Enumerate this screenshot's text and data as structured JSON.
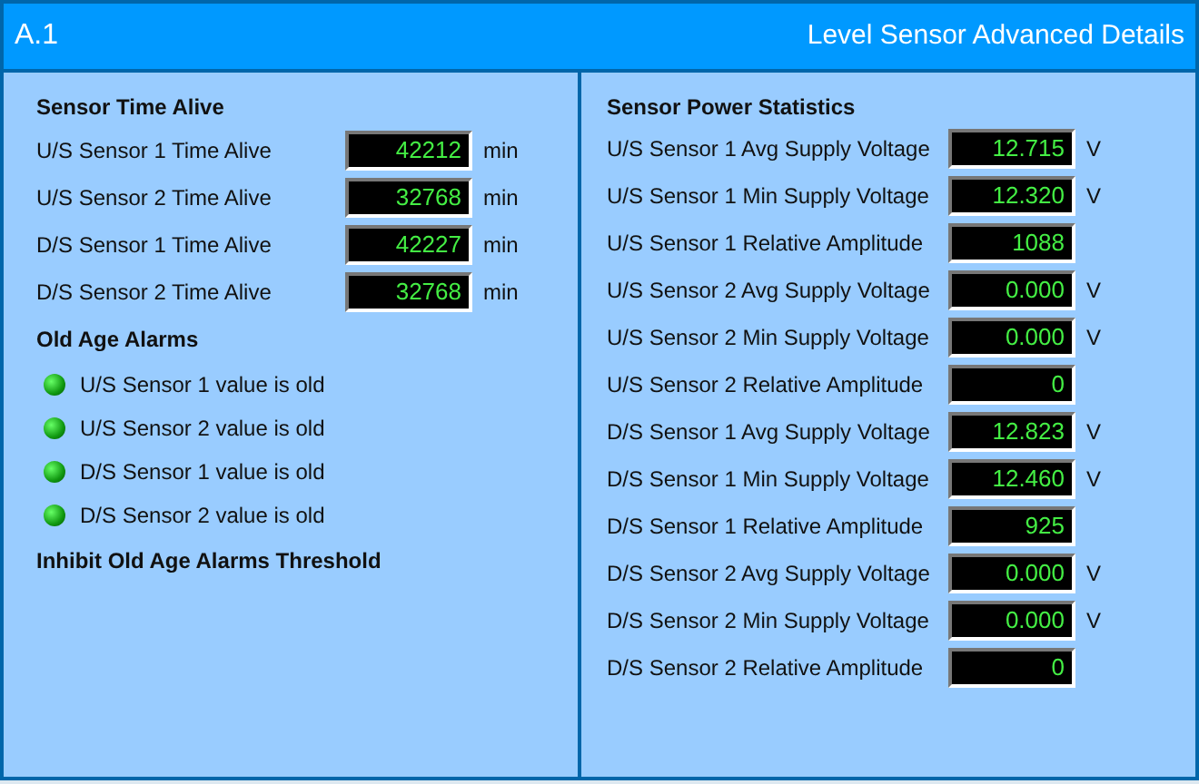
{
  "header": {
    "id": "A.1",
    "title": "Level Sensor Advanced Details"
  },
  "time_alive": {
    "heading": "Sensor Time Alive",
    "rows": [
      {
        "label": "U/S Sensor 1 Time Alive",
        "value": "42212",
        "unit": "min"
      },
      {
        "label": "U/S Sensor 2 Time Alive",
        "value": "32768",
        "unit": "min"
      },
      {
        "label": "D/S Sensor 1 Time Alive",
        "value": "42227",
        "unit": "min"
      },
      {
        "label": "D/S Sensor 2 Time Alive",
        "value": "32768",
        "unit": "min"
      }
    ]
  },
  "alarms": {
    "heading": "Old Age Alarms",
    "items": [
      {
        "label": "U/S Sensor 1 value is old",
        "on": true
      },
      {
        "label": "U/S Sensor 2 value is old",
        "on": true
      },
      {
        "label": "D/S Sensor 1 value is old",
        "on": true
      },
      {
        "label": "D/S Sensor 2 value is old",
        "on": true
      }
    ]
  },
  "inhibit": {
    "heading": "Inhibit Old Age Alarms Threshold"
  },
  "power": {
    "heading": "Sensor Power Statistics",
    "rows": [
      {
        "label": "U/S Sensor 1 Avg Supply Voltage",
        "value": "12.715",
        "unit": "V"
      },
      {
        "label": "U/S Sensor 1 Min Supply Voltage",
        "value": "12.320",
        "unit": "V"
      },
      {
        "label": "U/S Sensor 1 Relative Amplitude",
        "value": "1088"
      },
      {
        "label": "U/S Sensor 2 Avg Supply Voltage",
        "value": "0.000",
        "unit": "V"
      },
      {
        "label": "U/S Sensor 2 Min Supply Voltage",
        "value": "0.000",
        "unit": "V"
      },
      {
        "label": "U/S Sensor 2 Relative Amplitude",
        "value": "0"
      },
      {
        "label": "D/S Sensor 1 Avg Supply Voltage",
        "value": "12.823",
        "unit": "V"
      },
      {
        "label": "D/S Sensor 1 Min Supply Voltage",
        "value": "12.460",
        "unit": "V"
      },
      {
        "label": "D/S Sensor 1 Relative Amplitude",
        "value": "925"
      },
      {
        "label": "D/S Sensor 2 Avg Supply Voltage",
        "value": "0.000",
        "unit": "V"
      },
      {
        "label": "D/S Sensor 2 Min Supply Voltage",
        "value": "0.000",
        "unit": "V"
      },
      {
        "label": "D/S Sensor 2 Relative Amplitude",
        "value": "0"
      }
    ]
  }
}
